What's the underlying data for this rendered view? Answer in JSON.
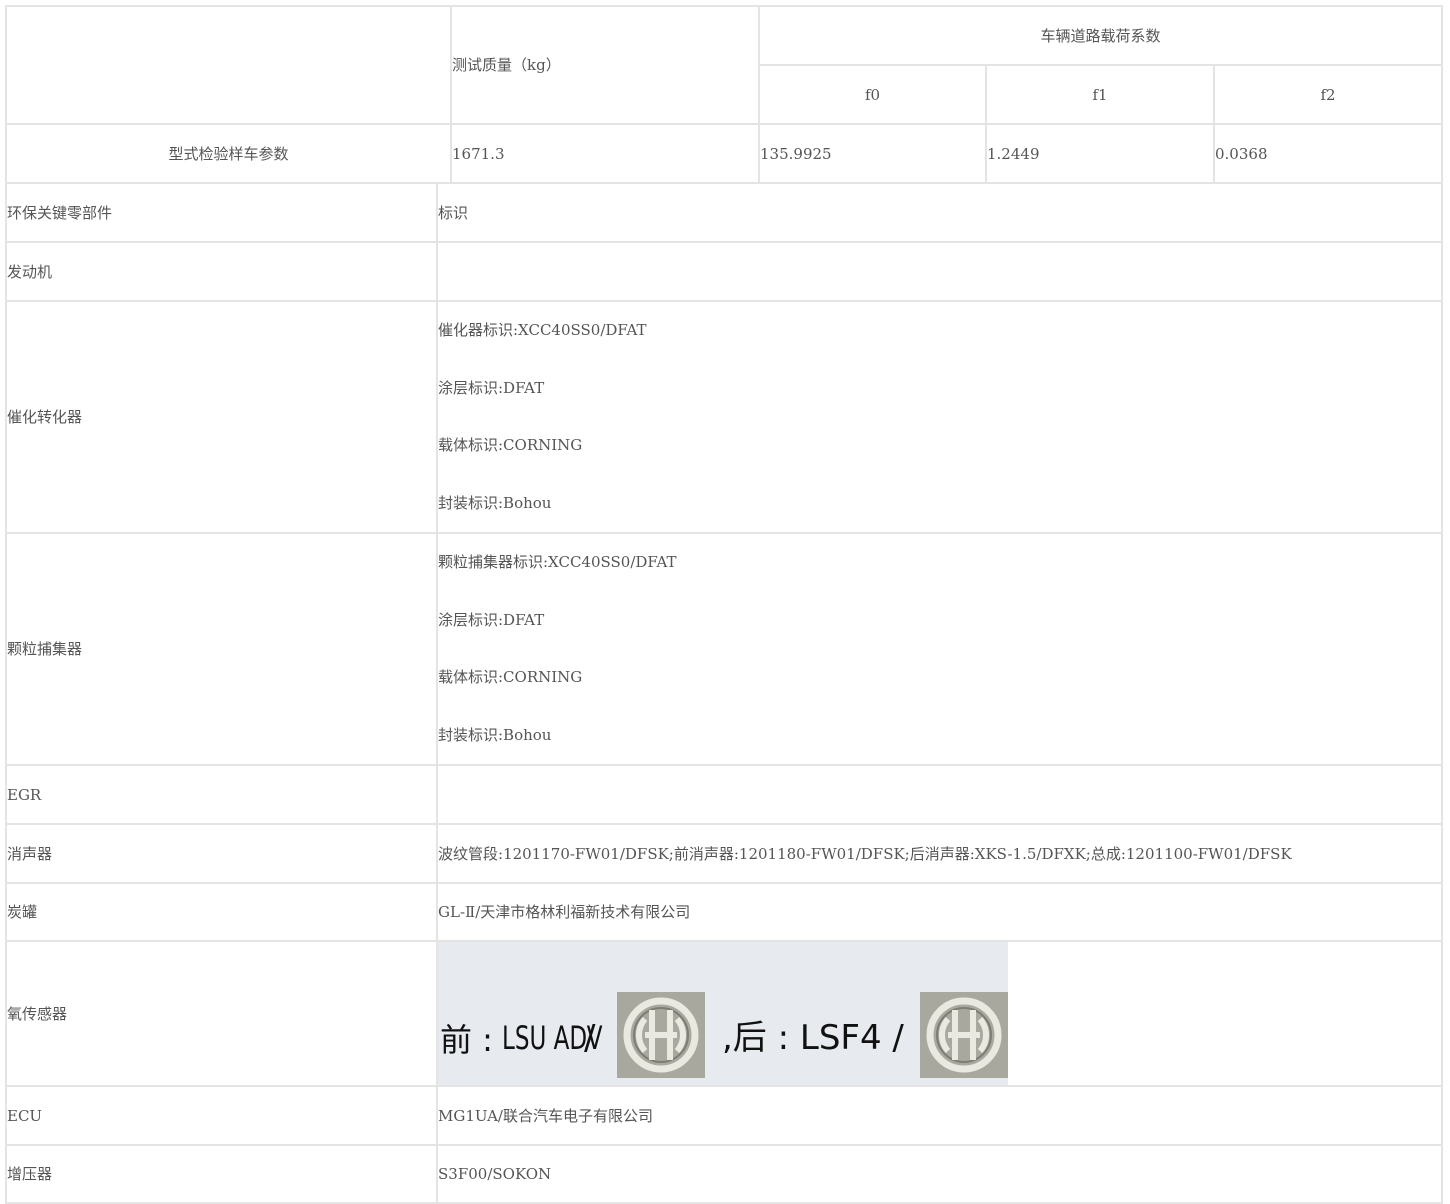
{
  "header": {
    "test_mass": "测试质量（kg）",
    "road_load": "车辆道路载荷系数",
    "f0": "f0",
    "f1": "f1",
    "f2": "f2"
  },
  "sample_row": {
    "label": "型式检验样车参数",
    "mass": "1671.3",
    "f0": "135.9925",
    "f1": "1.2449",
    "f2": "0.0368"
  },
  "parts": {
    "col_component": "环保关键零部件",
    "col_mark": "标识",
    "engine": {
      "name": "发动机",
      "value": ""
    },
    "catalyst": {
      "name": "催化转化器",
      "lines": [
        "催化器标识:XCC40SS0/DFAT",
        "涂层标识:DFAT",
        "载体标识:CORNING",
        "封装标识:Bohou"
      ]
    },
    "particulate": {
      "name": "颗粒捕集器",
      "lines": [
        "颗粒捕集器标识:XCC40SS0/DFAT",
        "涂层标识:DFAT",
        "载体标识:CORNING",
        "封装标识:Bohou"
      ]
    },
    "egr": {
      "name": "EGR",
      "value": ""
    },
    "muffler": {
      "name": "消声器",
      "value": "波纹管段:1201170-FW01/DFSK;前消声器:1201180-FW01/DFSK;后消声器:XKS-1.5/DFXK;总成:1201100-FW01/DFSK"
    },
    "canister": {
      "name": "炭罐",
      "value": "GL-Ⅱ/天津市格林利福新技术有限公司"
    },
    "o2_sensor": {
      "name": "氧传感器",
      "front_label": "前 :",
      "front_model": "LSU ADV",
      "slash": "/",
      "rear_label": ",后 : LSF4 /",
      "logo_icon": "bosch-logo-icon"
    },
    "ecu": {
      "name": "ECU",
      "value": "MG1UA/联合汽车电子有限公司"
    },
    "turbo": {
      "name": "增压器",
      "value": "S3F00/SOKON"
    }
  }
}
